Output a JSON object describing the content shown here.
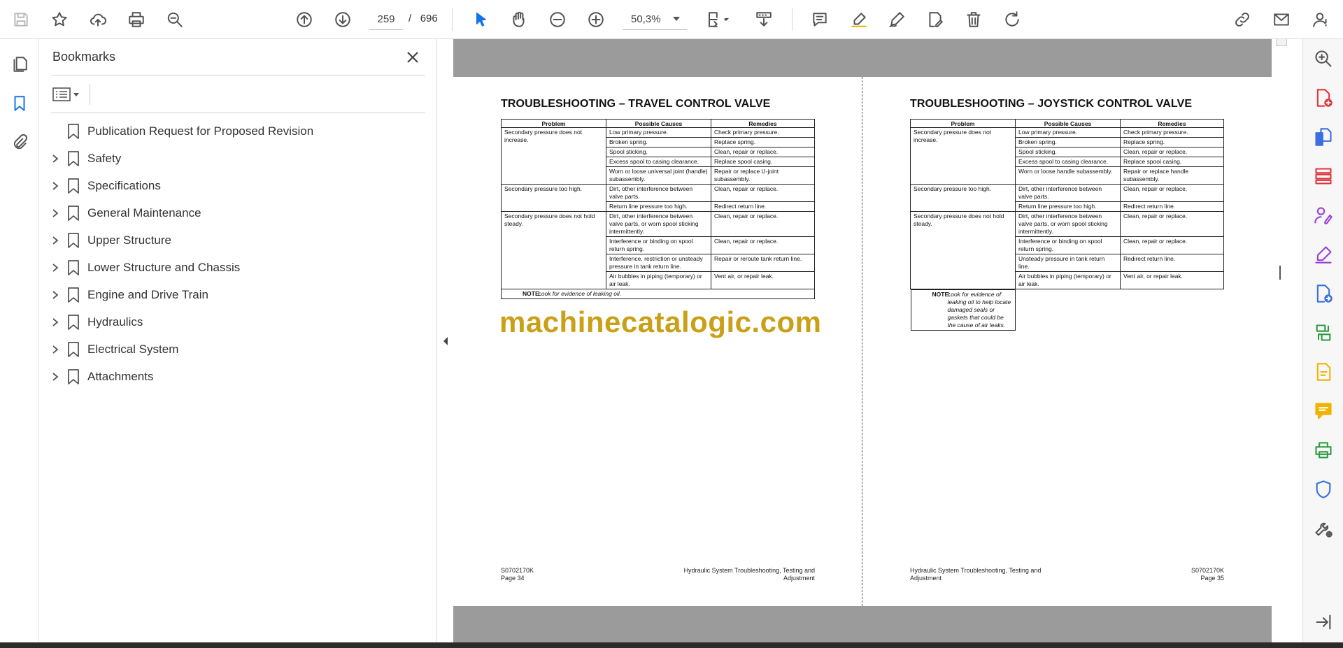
{
  "toolbar": {
    "current_page": "259",
    "page_separator": "/",
    "total_pages": "696",
    "zoom": "50,3%",
    "icons": [
      "save-icon",
      "star-icon",
      "upload-icon",
      "print-icon",
      "zoom-search-icon",
      "page-up-icon",
      "page-down-icon",
      "select-cursor-icon",
      "hand-icon",
      "zoom-out-icon",
      "zoom-in-icon",
      "fit-page-icon",
      "scroll-mode-icon",
      "comment-icon",
      "highlight-icon",
      "sign-icon",
      "edit-icon",
      "delete-icon",
      "rotate-icon",
      "share-link-icon",
      "email-icon",
      "account-icon"
    ]
  },
  "bookmarks": {
    "title": "Bookmarks",
    "items": [
      {
        "label": "Publication Request for Proposed Revision",
        "expandable": false
      },
      {
        "label": "Safety",
        "expandable": true
      },
      {
        "label": "Specifications",
        "expandable": true
      },
      {
        "label": "General Maintenance",
        "expandable": true
      },
      {
        "label": "Upper Structure",
        "expandable": true
      },
      {
        "label": "Lower Structure and Chassis",
        "expandable": true
      },
      {
        "label": "Engine and Drive Train",
        "expandable": true
      },
      {
        "label": "Hydraulics",
        "expandable": true
      },
      {
        "label": "Electrical System",
        "expandable": true
      },
      {
        "label": "Attachments",
        "expandable": true
      }
    ]
  },
  "left_page": {
    "title": "TROUBLESHOOTING – TRAVEL CONTROL VALVE",
    "headers": [
      "Problem",
      "Possible Causes",
      "Remedies"
    ],
    "groups": [
      {
        "problem": "Secondary pressure does not increase.",
        "rows": [
          [
            "Low primary pressure.",
            "Check primary pressure."
          ],
          [
            "Broken spring.",
            "Replace spring."
          ],
          [
            "Spool sticking.",
            "Clean, repair or replace."
          ],
          [
            "Excess spool to casing clearance.",
            "Replace spool casing."
          ],
          [
            "Worn or loose universal joint (handle) subassembly.",
            "Repair or replace U-joint subassembly."
          ]
        ]
      },
      {
        "problem": "Secondary pressure too high.",
        "rows": [
          [
            "Dirt, other interference between valve parts.",
            "Clean, repair or replace."
          ],
          [
            "Return line pressure too high.",
            "Redirect return line."
          ]
        ]
      },
      {
        "problem": "Secondary pressure does not hold steady.",
        "rows": [
          [
            "Dirt, other interference between valve parts, or worn spool sticking intermittently.",
            "Clean, repair or replace."
          ],
          [
            "Interference or binding on spool return spring.",
            "Clean, repair or replace."
          ],
          [
            "Interference, restriction or unsteady pressure in tank return line.",
            "Repair or reroute tank return line."
          ],
          [
            "Air bubbles in piping (temporary) or air leak.",
            "Vent air, or repair leak."
          ]
        ]
      }
    ],
    "note_label": "NOTE:",
    "note_text": "Look for evidence of leaking oil.",
    "footer_left_1": "S0702170K",
    "footer_left_2": "Page 34",
    "footer_right_1": "Hydraulic System Troubleshooting, Testing and",
    "footer_right_2": "Adjustment"
  },
  "right_page": {
    "title": "TROUBLESHOOTING – JOYSTICK CONTROL VALVE",
    "headers": [
      "Problem",
      "Possible Causes",
      "Remedies"
    ],
    "groups": [
      {
        "problem": "Secondary pressure does not increase.",
        "rows": [
          [
            "Low primary pressure.",
            "Check primary pressure."
          ],
          [
            "Broken spring.",
            "Replace spring."
          ],
          [
            "Spool sticking.",
            "Clean, repair or replace."
          ],
          [
            "Excess spool to casing clearance.",
            "Replace spool casing."
          ],
          [
            "Worn or loose handle subassembly.",
            "Repair or replace handle subassembly."
          ]
        ]
      },
      {
        "problem": "Secondary pressure too high.",
        "rows": [
          [
            "Dirt, other interference between valve parts.",
            "Clean, repair or replace."
          ],
          [
            "Return line pressure too high.",
            "Redirect return line."
          ]
        ]
      },
      {
        "problem": "Secondary pressure does not hold steady.",
        "rows": [
          [
            "Dirt, other interference between valve parts, or worn spool sticking intermittently.",
            "Clean, repair or replace."
          ],
          [
            "Interference or binding on spool return spring.",
            "Clean, repair or replace."
          ],
          [
            "Unsteady pressure in tank return line.",
            "Redirect return line."
          ],
          [
            "Air bubbles in piping (temporary) or air leak.",
            "Vent air, or repair leak."
          ]
        ]
      }
    ],
    "note_label": "NOTE:",
    "note_text": "Look for evidence of leaking oil to help locate damaged seals or gaskets that could be the cause of air leaks.",
    "footer_left_1": "Hydraulic System Troubleshooting, Testing and",
    "footer_left_2": "Adjustment",
    "footer_right_1": "S0702170K",
    "footer_right_2": "Page 35"
  },
  "watermark": "machinecatalogic.com",
  "colors": {
    "accent": "#1473e6",
    "watermark": "#c9a018",
    "page_gutter": "#9b9b9b",
    "tool_red": "#e0363b",
    "tool_blue": "#3b6fe0",
    "tool_purple": "#9a3fd4",
    "tool_green": "#2f9a41",
    "tool_yellow": "#f0b400"
  },
  "right_tools": [
    "search-enhance-icon",
    "create-pdf-icon",
    "combine-files-icon",
    "organize-pages-icon",
    "request-signature-icon",
    "fill-sign-icon",
    "export-pdf-icon",
    "compress-icon",
    "convert-icon",
    "comment-tool-icon",
    "scan-ocr-icon",
    "protect-icon",
    "more-tools-icon",
    "expand-panel-icon"
  ]
}
